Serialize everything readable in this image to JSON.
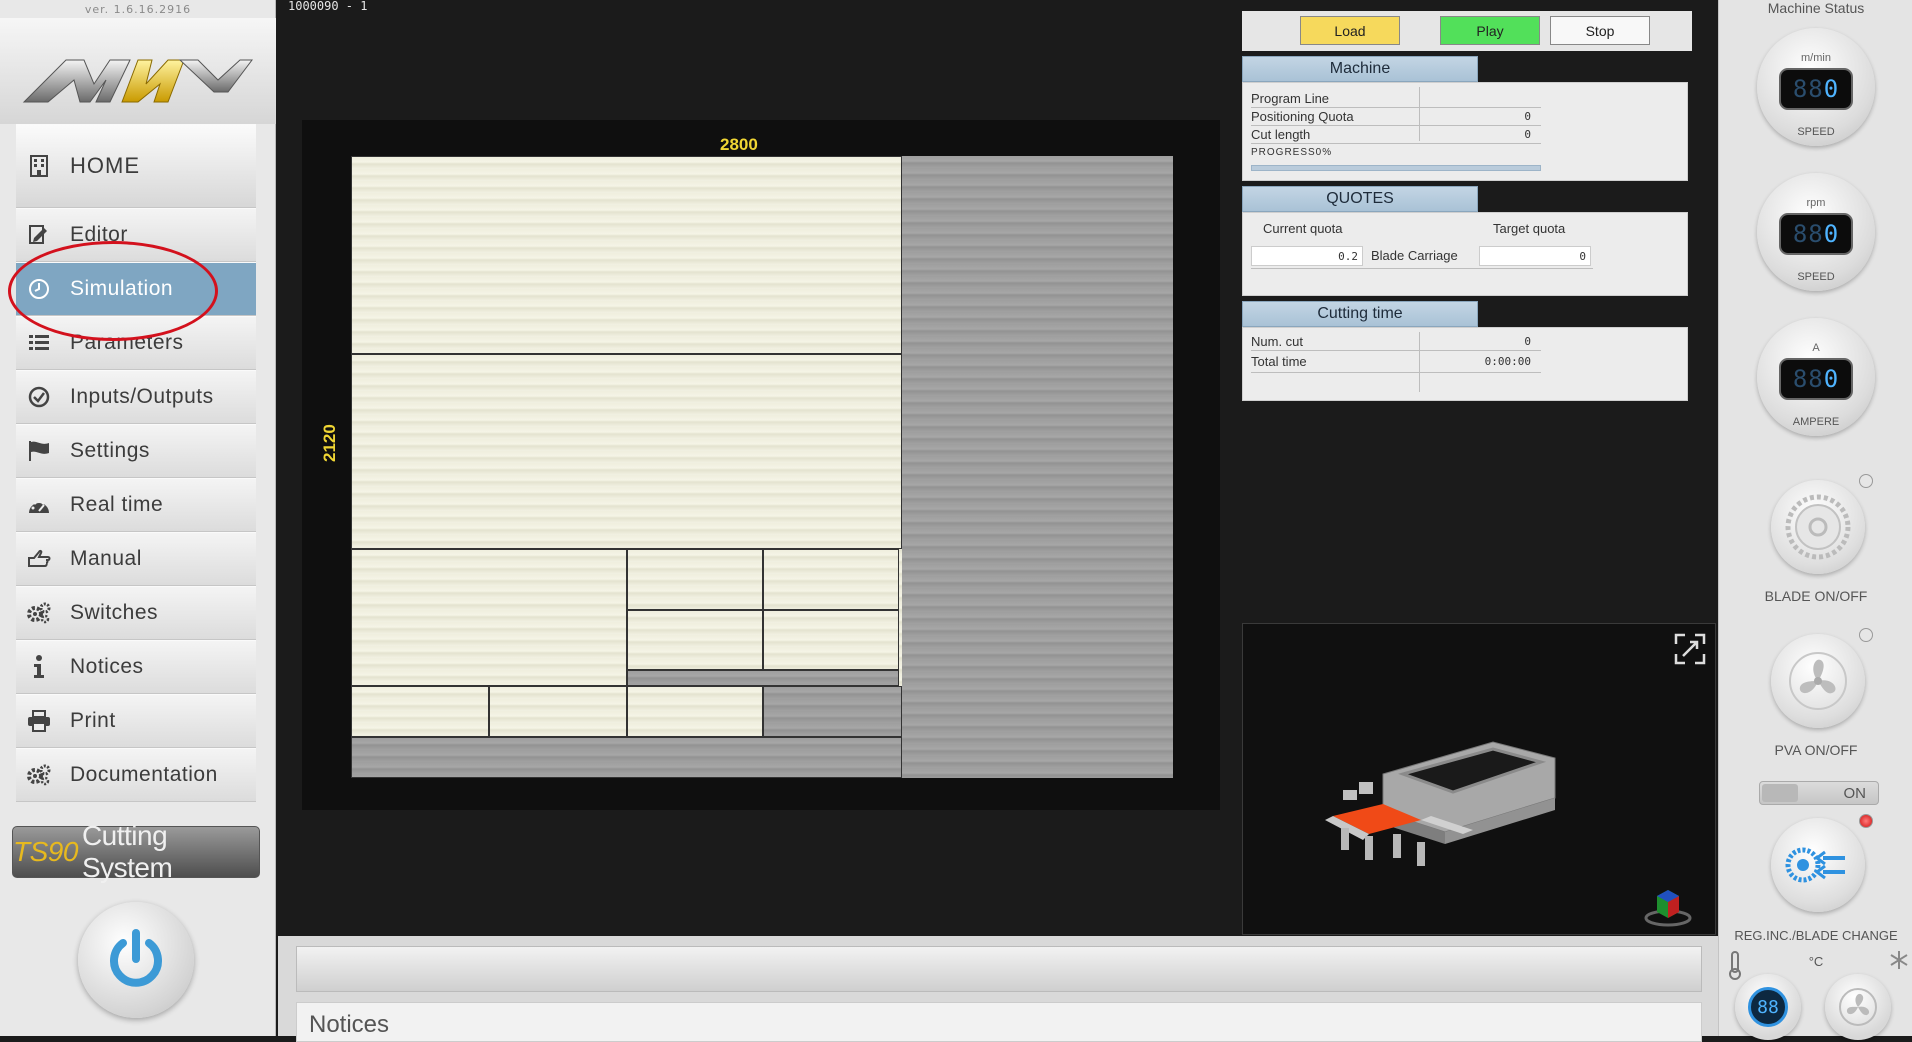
{
  "app": {
    "version": "ver. 1.6.16.2916",
    "program_title": "1000090 - 1"
  },
  "sidebar": {
    "items": [
      {
        "label": "HOME",
        "icon": "building-icon"
      },
      {
        "label": "Editor",
        "icon": "edit-document-icon"
      },
      {
        "label": "Simulation",
        "icon": "clock-icon",
        "active": true
      },
      {
        "label": "Parameters",
        "icon": "list-icon"
      },
      {
        "label": "Inputs/Outputs",
        "icon": "check-circle-icon"
      },
      {
        "label": "Settings",
        "icon": "flag-icon"
      },
      {
        "label": "Real time",
        "icon": "dashboard-icon"
      },
      {
        "label": "Manual",
        "icon": "hand-pointer-icon"
      },
      {
        "label": "Switches",
        "icon": "gears-icon"
      },
      {
        "label": "Notices",
        "icon": "info-icon"
      },
      {
        "label": "Print",
        "icon": "printer-icon"
      },
      {
        "label": "Documentation",
        "icon": "gears-icon"
      }
    ],
    "brand_model": "TS90",
    "brand_name": "Cutting System"
  },
  "controls": {
    "load": "Load",
    "play": "Play",
    "stop": "Stop"
  },
  "sheet": {
    "width_label": "2800",
    "height_label": "2120"
  },
  "machine": {
    "title": "Machine",
    "program_line_label": "Program Line",
    "program_line_value": "",
    "positioning_quota_label": "Positioning Quota",
    "positioning_quota_value": "0",
    "cut_length_label": "Cut length",
    "cut_length_value": "0",
    "progress_label": "PROGRESS0%",
    "progress": 0
  },
  "quotes": {
    "title": "QUOTES",
    "current_label": "Current quota",
    "target_label": "Target quota",
    "current_value": "0.2",
    "blade_carriage_label": "Blade Carriage",
    "target_value": "0"
  },
  "cutting_time": {
    "title": "Cutting time",
    "num_cut_label": "Num. cut",
    "num_cut_value": "0",
    "total_time_label": "Total time",
    "total_time_value": "0:00:00"
  },
  "notices": {
    "title": "Notices"
  },
  "machine_status": {
    "title": "Machine Status",
    "speed1": {
      "unit": "m/min",
      "value": "0",
      "label": "SPEED"
    },
    "speed2": {
      "unit": "rpm",
      "value": "0",
      "label": "SPEED"
    },
    "ampere": {
      "unit": "A",
      "value": "0",
      "label": "AMPERE"
    },
    "blade_label": "BLADE ON/OFF",
    "pva_label": "PVA ON/OFF",
    "toggle_label": "ON",
    "reg_label": "REG.INC./BLADE CHANGE",
    "temp_unit": "°C"
  },
  "colors": {
    "active": "#7fa6c2",
    "load": "#f6d95c",
    "play": "#52e05a",
    "dimension": "#f0d634",
    "annotation": "#d3111d"
  }
}
